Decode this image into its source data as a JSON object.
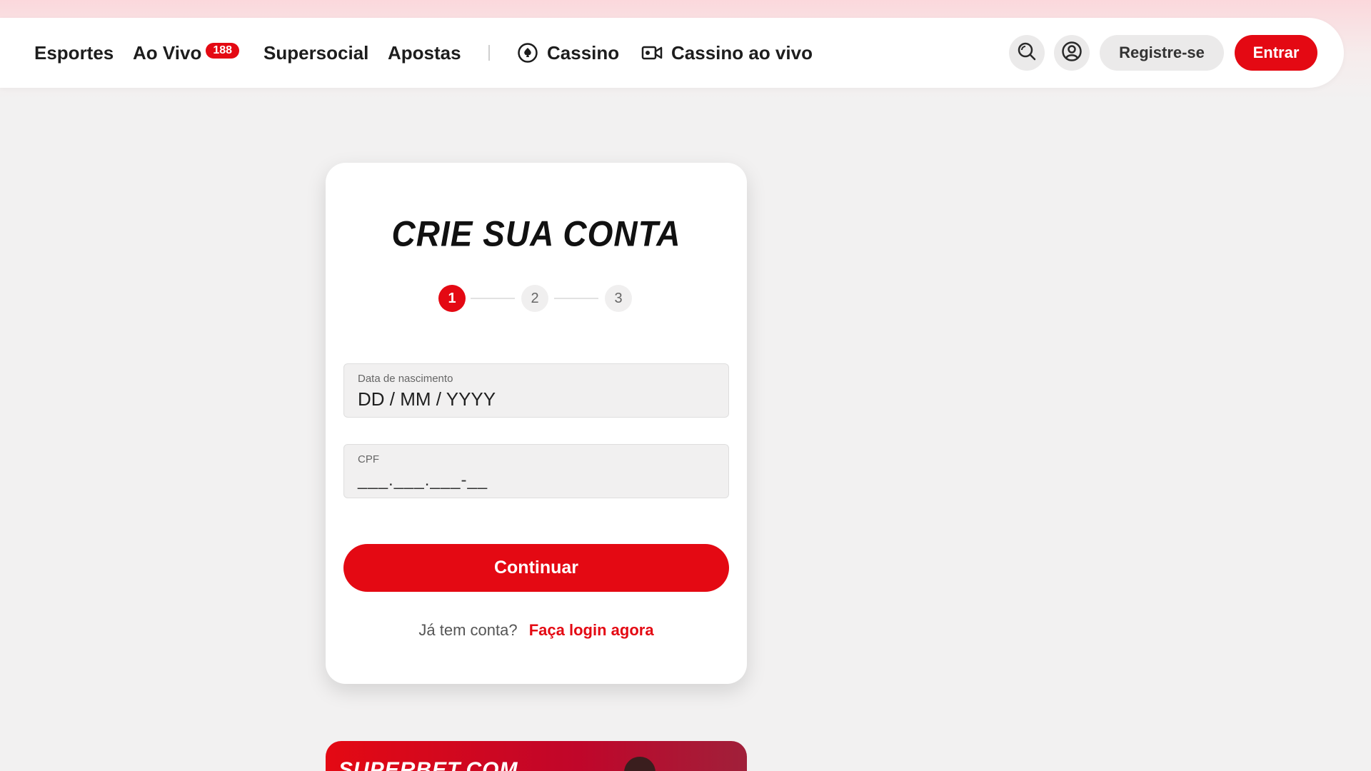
{
  "nav": {
    "items": [
      {
        "label": "Esportes"
      },
      {
        "label": "Ao Vivo",
        "badge": "188"
      },
      {
        "label": "Supersocial"
      },
      {
        "label": "Apostas"
      },
      {
        "label": "Cassino",
        "icon": "casino-chip-icon"
      },
      {
        "label": "Cassino ao vivo",
        "icon": "video-camera-icon"
      }
    ],
    "register_label": "Registre-se",
    "login_label": "Entrar"
  },
  "signup": {
    "title": "CRIE SUA CONTA",
    "steps": [
      "1",
      "2",
      "3"
    ],
    "current_step": 1,
    "birthdate": {
      "label": "Data de nascimento",
      "placeholder": "DD / MM / YYYY"
    },
    "cpf": {
      "label": "CPF",
      "mask": "___.___.___-__"
    },
    "continue_label": "Continuar",
    "has_account_text": "Já tem conta?",
    "login_link": "Faça login agora"
  },
  "banner": {
    "text": "SUPERBET.COM"
  },
  "colors": {
    "accent": "#e40913",
    "background": "#f2f1f1"
  }
}
